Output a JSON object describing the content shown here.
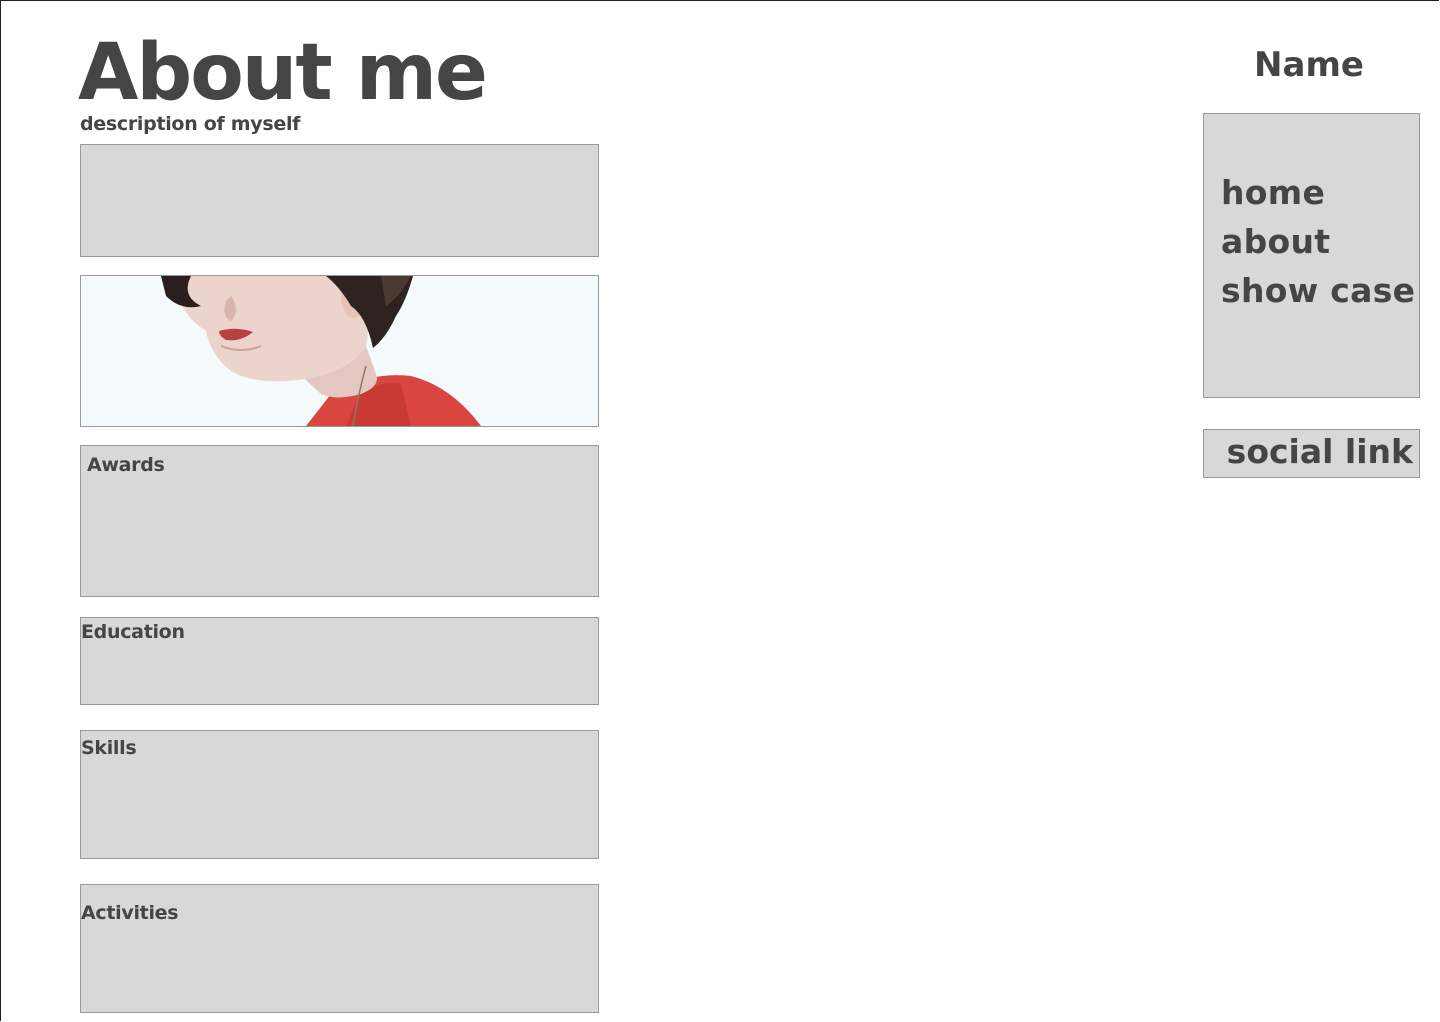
{
  "header": {
    "title": "About me",
    "subtitle": "description of myself"
  },
  "sections": {
    "awards": "Awards",
    "education": "Education",
    "skills": "Skills",
    "activities": "Activities"
  },
  "sidebar": {
    "name": "Name",
    "nav": [
      "home",
      "about",
      "show case"
    ],
    "social": "social link"
  },
  "colors": {
    "text": "#454545",
    "box_fill": "#d8d8d8",
    "box_border": "#9a9a9a"
  }
}
